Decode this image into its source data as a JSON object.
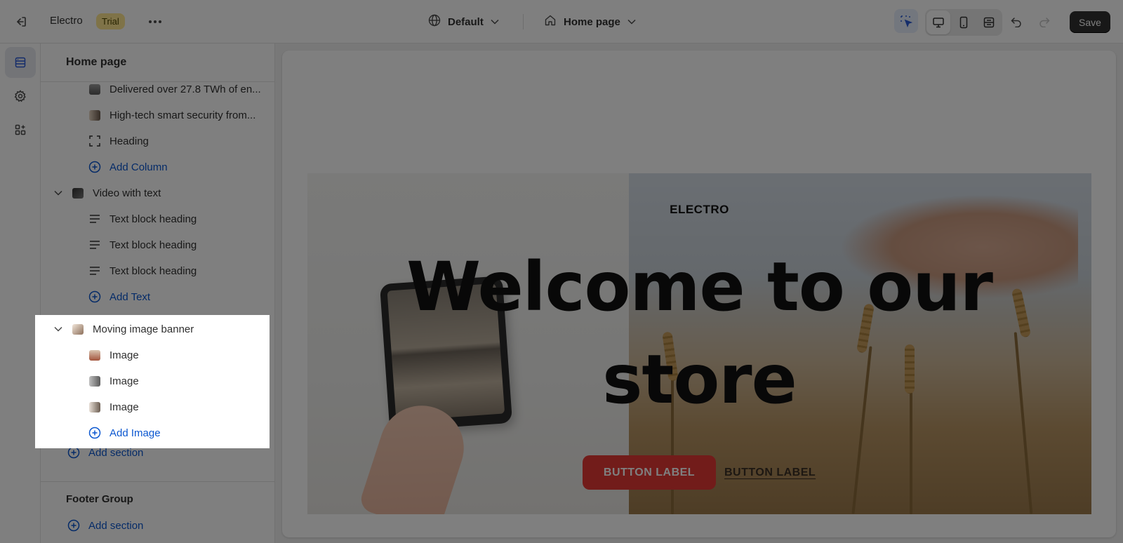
{
  "topbar": {
    "store_name": "Electro",
    "plan_badge": "Trial",
    "theme_label": "Default",
    "page_label": "Home page",
    "save_label": "Save"
  },
  "sidebar": {
    "title": "Home page",
    "rows": [
      {
        "label": "Delivered over 27.8 TWh of en...",
        "type": "block",
        "icon": "image-thumbnail"
      },
      {
        "label": "High-tech smart security from...",
        "type": "block",
        "icon": "image-thumbnail"
      },
      {
        "label": "Heading",
        "type": "block",
        "icon": "heading-frame-icon"
      },
      {
        "label": "Add Column",
        "type": "add",
        "icon": "plus-circle-icon"
      },
      {
        "label": "Video with text",
        "type": "section",
        "icon": "video-thumbnail"
      },
      {
        "label": "Text block heading",
        "type": "block",
        "icon": "text-lines-icon"
      },
      {
        "label": "Text block heading",
        "type": "block",
        "icon": "text-lines-icon"
      },
      {
        "label": "Text block heading",
        "type": "block",
        "icon": "text-lines-icon"
      },
      {
        "label": "Add Text",
        "type": "add",
        "icon": "plus-circle-icon"
      }
    ],
    "highlighted_section": {
      "label": "Moving image banner",
      "blocks": [
        "Image",
        "Image",
        "Image"
      ],
      "add_label": "Add Image"
    },
    "add_section_label": "Add section",
    "footer_group": {
      "title": "Footer Group",
      "add_section_label": "Add section"
    }
  },
  "preview": {
    "brand": "ELECTRO",
    "heading_line1": "Welcome to our",
    "heading_line2": "store",
    "button_primary": "BUTTON LABEL",
    "button_secondary": "BUTTON LABEL"
  },
  "colors": {
    "accent_blue": "#0b57d0",
    "badge_bg": "#ffe790",
    "save_bg": "#303030",
    "banner_button": "#e53935"
  }
}
